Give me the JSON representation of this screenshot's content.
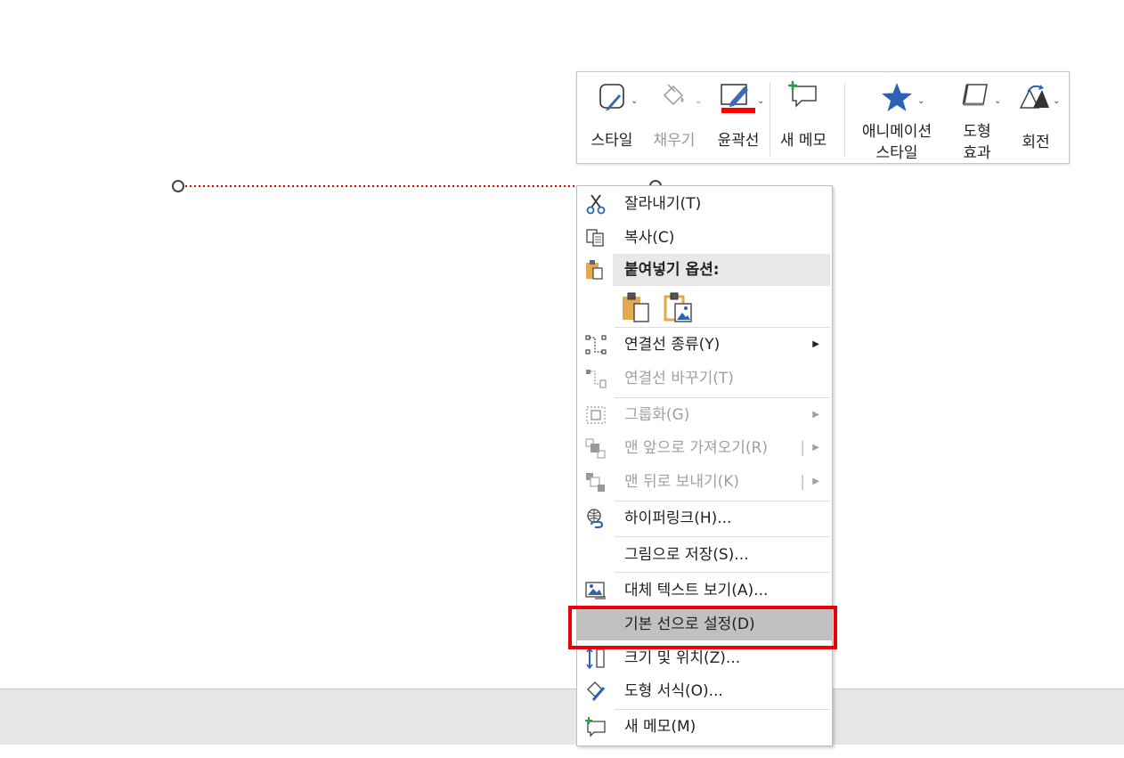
{
  "mini_toolbar": {
    "style_label": "스타일",
    "fill_label": "채우기",
    "outline_label": "윤곽선",
    "new_memo_label": "새 메모",
    "animation_style_label_1": "애니메이션",
    "animation_style_label_2": "스타일",
    "shape_effect_label_1": "도형",
    "shape_effect_label_2": "효과",
    "rotate_label": "회전",
    "outline_color": "#ff0000"
  },
  "context_menu": {
    "cut": "잘라내기(T)",
    "copy": "복사(C)",
    "paste_options": "붙여넣기 옵션:",
    "connector_type": "연결선 종류(Y)",
    "reroute_connector": "연결선 바꾸기(T)",
    "group": "그룹화(G)",
    "bring_to_front": "맨 앞으로 가져오기(R)",
    "send_to_back": "맨 뒤로 보내기(K)",
    "hyperlink": "하이퍼링크(H)...",
    "save_as_picture": "그림으로 저장(S)...",
    "alt_text": "대체 텍스트 보기(A)...",
    "set_default_line": "기본 선으로 설정(D)",
    "size_position": "크기 및 위치(Z)...",
    "format_shape": "도형 서식(O)...",
    "new_memo": "새 메모(M)",
    "highlight_color": "#e8000b"
  },
  "connector": {
    "color": "#e00000"
  }
}
